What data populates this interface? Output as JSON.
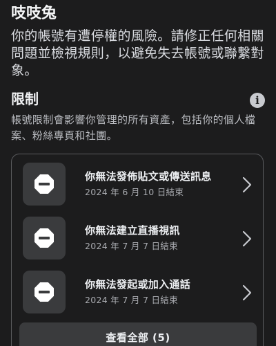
{
  "account": {
    "name": "吱吱兔",
    "warning": "你的帳號有遭停權的風險。請修正任何相關問題並檢視規則，以避免失去帳號或聯繫對象。"
  },
  "restrictions": {
    "title": "限制",
    "info_icon": "info-icon",
    "description": "帳號限制會影響你管理的所有資產，包括你的個人檔案、粉絲專頁和社團。",
    "items": [
      {
        "icon": "stop-sign-icon",
        "title": "你無法發佈貼文或傳送訊息",
        "date": "2024 年 6 月 10 日結束"
      },
      {
        "icon": "stop-sign-icon",
        "title": "你無法建立直播視訊",
        "date": "2024 年 7 月 7 日結束"
      },
      {
        "icon": "stop-sign-icon",
        "title": "你無法發起或加入通話",
        "date": "2024 年 7 月 7 日結束"
      }
    ],
    "view_all_label": "查看全部 (5)"
  },
  "colors": {
    "background": "#1c1c1d",
    "card_border": "#5a5b5e",
    "icon_tile": "#3a3b3d",
    "stop_sign": "#ffffff"
  }
}
